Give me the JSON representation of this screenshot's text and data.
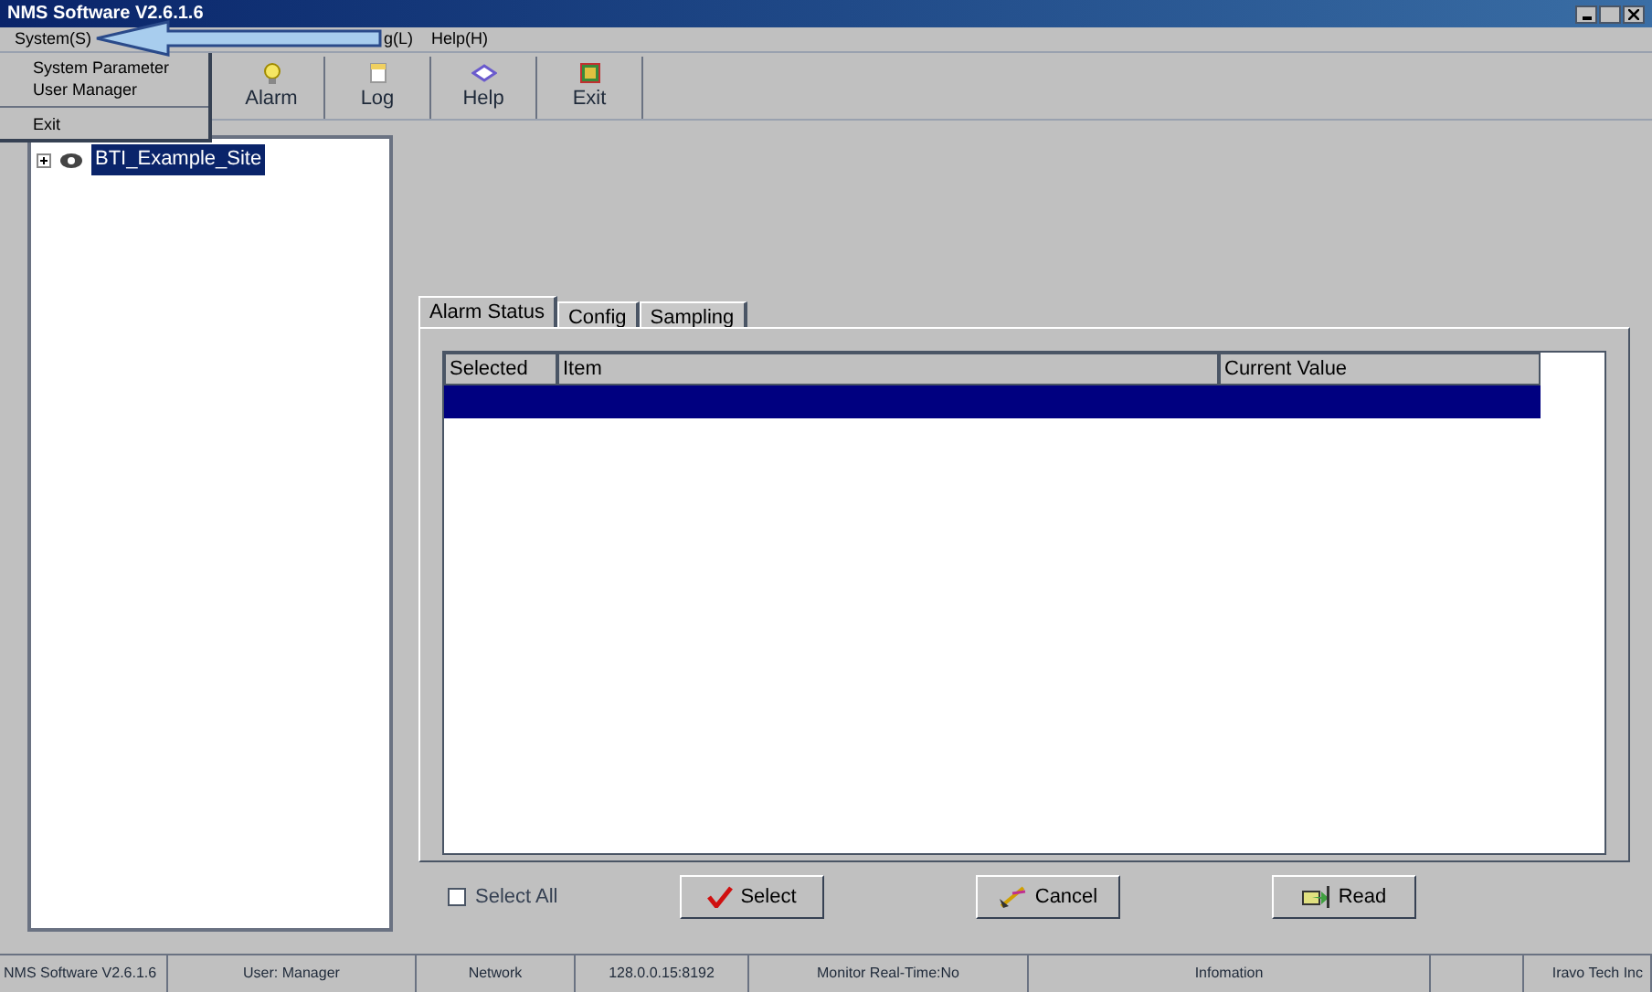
{
  "window": {
    "title": "NMS Software V2.6.1.6"
  },
  "menu_bar": [
    "System(S)",
    "g(L)",
    "Help(H)"
  ],
  "system_menu": {
    "items": [
      {
        "label": "System Parameter",
        "kind": "item"
      },
      {
        "label": "User Manager",
        "kind": "item"
      },
      {
        "kind": "separator"
      },
      {
        "label": "Exit",
        "kind": "item"
      }
    ]
  },
  "toolbar": [
    "Alarm",
    "Log",
    "Help",
    "Exit"
  ],
  "tree": [
    {
      "label": "BTI_Example_Site",
      "selected": true,
      "expanded": false
    }
  ],
  "tabs": [
    {
      "label": "Alarm Status",
      "selected": true
    },
    {
      "label": "Config",
      "selected": false
    },
    {
      "label": "Sampling",
      "selected": false
    }
  ],
  "table": {
    "columns": [
      "Selected",
      "Item",
      "Current Value"
    ],
    "rows": [
      {
        "selected": true
      }
    ]
  },
  "select_all": {
    "label": "Select All",
    "checked": false
  },
  "buttons": [
    "Select",
    "Cancel",
    "Read"
  ],
  "status_bar": [
    "NMS Software V2.6.1.6",
    "User: Manager",
    "Network",
    "128.0.0.15:8192",
    "Monitor Real-Time:No",
    "Infomation",
    "Iravo Tech Inc"
  ]
}
